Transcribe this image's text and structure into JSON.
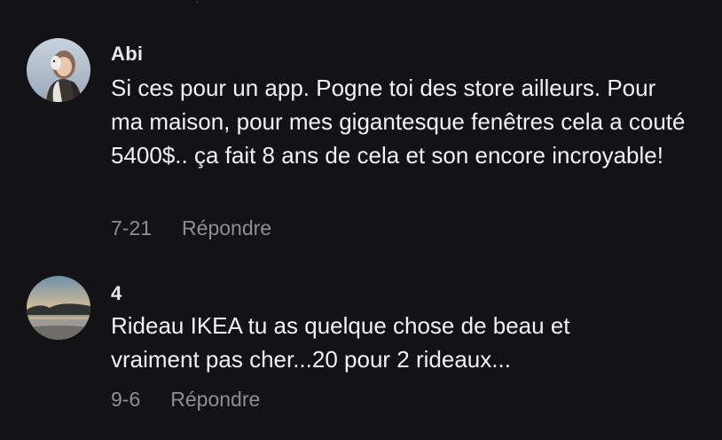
{
  "comments": [
    {
      "username": "Abi",
      "text": "Si ces pour un app. Pogne toi des store ailleurs. Pour ma maison, pour mes gigantesque fenêtres cela a couté 5400$.. ça fait 8 ans de cela et son encore incroyable!",
      "date": "7-21",
      "reply_label": "Répondre",
      "avatar_icon": "person-photo-avatar"
    },
    {
      "username": "4",
      "text": "Rideau IKEA tu as quelque chose de beau et vraiment pas cher...20 pour 2 rideaux...",
      "date": "9-6",
      "reply_label": "Répondre",
      "avatar_icon": "sunset-lake-avatar"
    }
  ],
  "colors": {
    "background": "#131215",
    "text": "#f2f2f4",
    "meta": "#8e8e93"
  }
}
